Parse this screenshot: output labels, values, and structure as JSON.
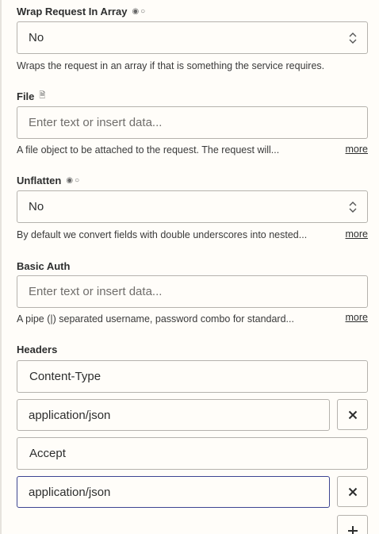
{
  "fields": {
    "wrap": {
      "label": "Wrap Request In Array",
      "icon": "radio-toggle-icon",
      "value": "No",
      "help": "Wraps the request in an array if that is something the service requires."
    },
    "file": {
      "label": "File",
      "icon": "document-icon",
      "placeholder": "Enter text or insert data...",
      "help": "A file object to be attached to the request. The request will...",
      "more": "more"
    },
    "unflatten": {
      "label": "Unflatten",
      "icon": "radio-toggle-icon",
      "value": "No",
      "help": "By default we convert fields with double underscores into nested...",
      "more": "more"
    },
    "basic_auth": {
      "label": "Basic Auth",
      "placeholder": "Enter text or insert data...",
      "help": "A pipe (|) separated username, password combo for standard...",
      "more": "more"
    },
    "headers": {
      "label": "Headers",
      "rows": [
        {
          "key": "Content-Type",
          "value": "application/json"
        },
        {
          "key": "Accept",
          "value": "application/json"
        }
      ]
    }
  },
  "colors": {
    "background": "#fffdf9",
    "border": "#b5b2ad",
    "focus_border": "#3d4592",
    "text": "#2d2e2e"
  }
}
